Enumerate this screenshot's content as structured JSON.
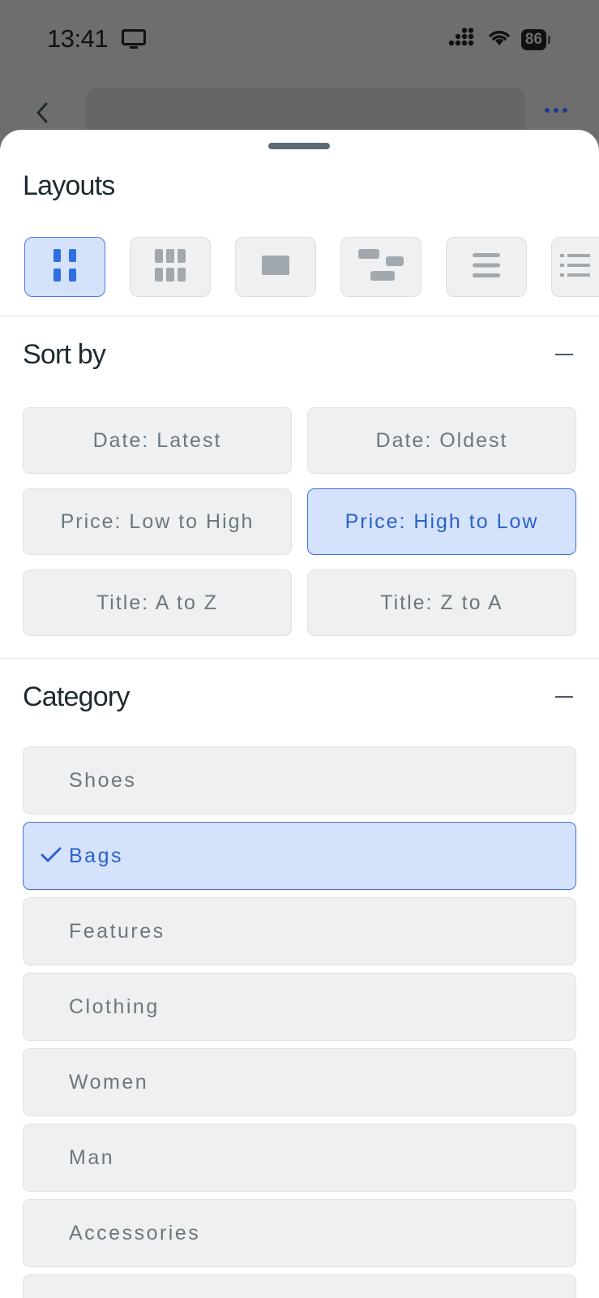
{
  "status_bar": {
    "time": "13:41",
    "battery": "86"
  },
  "sheet": {
    "layouts": {
      "title": "Layouts",
      "options": [
        {
          "icon": "grid-2-column-icon",
          "active": true
        },
        {
          "icon": "grid-3-column-icon",
          "active": false
        },
        {
          "icon": "single-block-icon",
          "active": false
        },
        {
          "icon": "staggered-blocks-icon",
          "active": false
        },
        {
          "icon": "list-lines-icon",
          "active": false
        },
        {
          "icon": "detailed-list-icon",
          "active": false
        }
      ]
    },
    "sort_by": {
      "title": "Sort by",
      "options": [
        {
          "label": "Date: Latest",
          "active": false
        },
        {
          "label": "Date: Oldest",
          "active": false
        },
        {
          "label": "Price: Low to High",
          "active": false
        },
        {
          "label": "Price: High to Low",
          "active": true
        },
        {
          "label": "Title: A to Z",
          "active": false
        },
        {
          "label": "Title: Z to A",
          "active": false
        }
      ]
    },
    "category": {
      "title": "Category",
      "items": [
        {
          "label": "Shoes",
          "selected": false
        },
        {
          "label": "Bags",
          "selected": true
        },
        {
          "label": "Features",
          "selected": false
        },
        {
          "label": "Clothing",
          "selected": false
        },
        {
          "label": "Women",
          "selected": false
        },
        {
          "label": "Man",
          "selected": false
        },
        {
          "label": "Accessories",
          "selected": false
        },
        {
          "label": "",
          "selected": false
        }
      ]
    }
  },
  "colors": {
    "accent": "#2a62c9",
    "selected_bg": "#d5e2fb",
    "chip_bg": "#eef0f1"
  }
}
